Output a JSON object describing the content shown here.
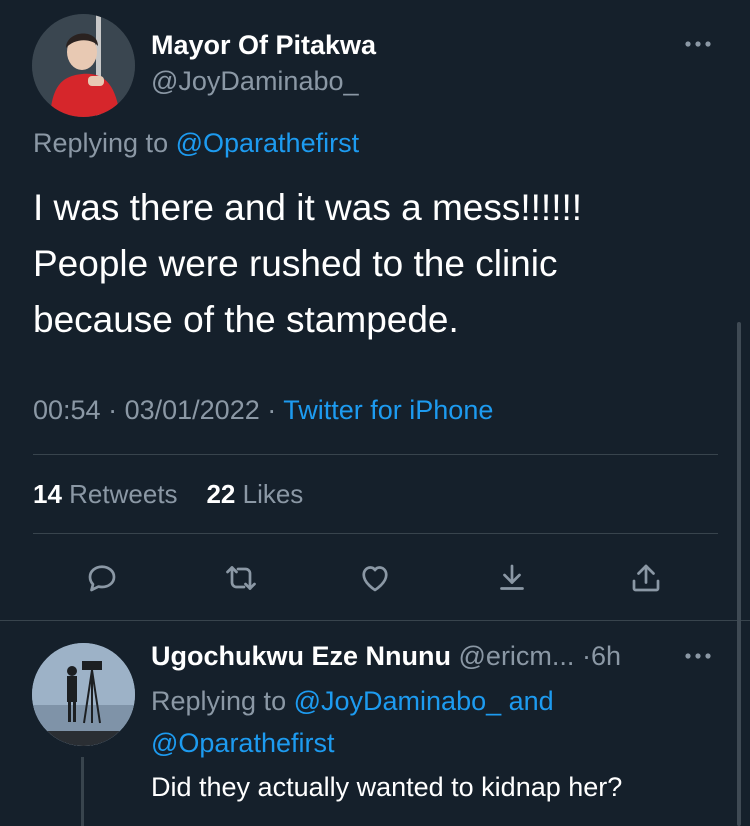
{
  "tweet": {
    "author_name": "Mayor Of Pitakwa",
    "author_handle": "@JoyDaminabo_",
    "replying_prefix": "Replying to",
    "replying_to": "@Oparathefirst",
    "text": "I was there and it was a mess!!!!!!\nPeople were rushed to the clinic\nbecause of the stampede.",
    "time": "00:54",
    "date": "03/01/2022",
    "source": "Twitter for iPhone",
    "retweets_count": "14",
    "retweets_label": "Retweets",
    "likes_count": "22",
    "likes_label": "Likes"
  },
  "actions": {
    "reply": "reply-icon",
    "retweet": "retweet-icon",
    "like": "heart-icon",
    "save": "bookmark-download-icon",
    "share": "share-icon"
  },
  "reply": {
    "author_name": "Ugochukwu Eze Nnunu",
    "author_handle": "@ericm...",
    "time": "6h",
    "replying_prefix": "Replying to",
    "replying_to_1": "@JoyDaminabo_",
    "replying_and": "and",
    "replying_to_2": "@Oparathefirst",
    "text": "Did they actually wanted to kidnap her?"
  },
  "colors": {
    "background": "#15202b",
    "accent": "#1d9bf0",
    "secondary_text": "#8b98a5",
    "divider": "#38444d"
  }
}
